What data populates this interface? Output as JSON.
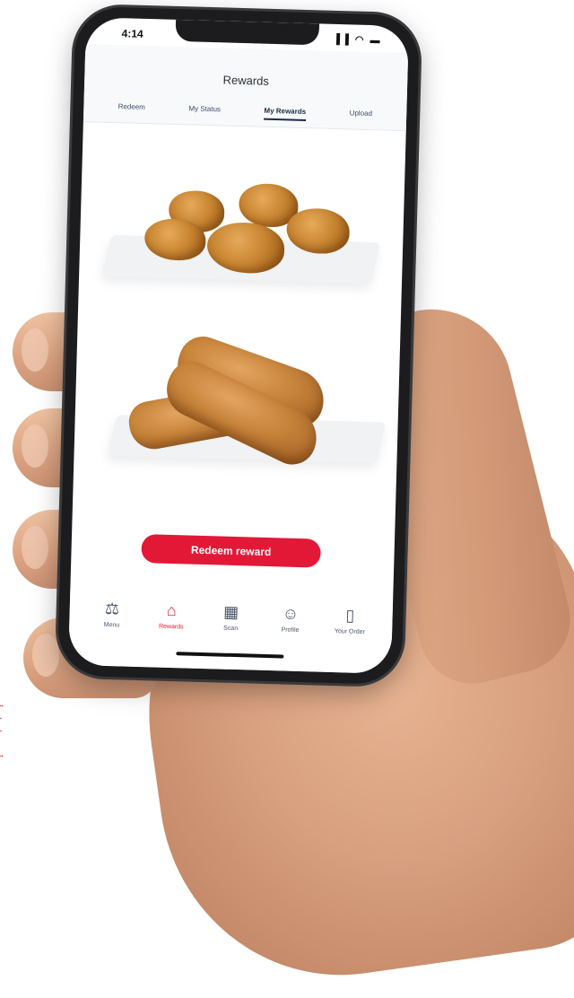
{
  "status_bar": {
    "time": "4:14",
    "icons": "▐▐ ◠ ▬"
  },
  "header": {
    "title": "Rewards",
    "tabs": [
      {
        "label": "Redeem",
        "active": false
      },
      {
        "label": "My Status",
        "active": false
      },
      {
        "label": "My Rewards",
        "active": true
      },
      {
        "label": "Upload",
        "active": false
      }
    ]
  },
  "main": {
    "redeem_button_label": "Redeem reward"
  },
  "bottom_nav": {
    "items": [
      {
        "label": "Menu",
        "icon": "fork-knife-icon",
        "glyph": "⚖",
        "active": false
      },
      {
        "label": "Rewards",
        "icon": "gift-icon",
        "glyph": "⌂",
        "active": true
      },
      {
        "label": "Scan",
        "icon": "qr-code-icon",
        "glyph": "▦",
        "active": false
      },
      {
        "label": "Profile",
        "icon": "user-icon",
        "glyph": "☺",
        "active": false
      },
      {
        "label": "Your Order",
        "icon": "bag-icon",
        "glyph": "▯",
        "active": false
      }
    ]
  },
  "colors": {
    "accent": "#e31837",
    "tab_text": "#3b4f6b",
    "nav_text": "#4a5568"
  }
}
